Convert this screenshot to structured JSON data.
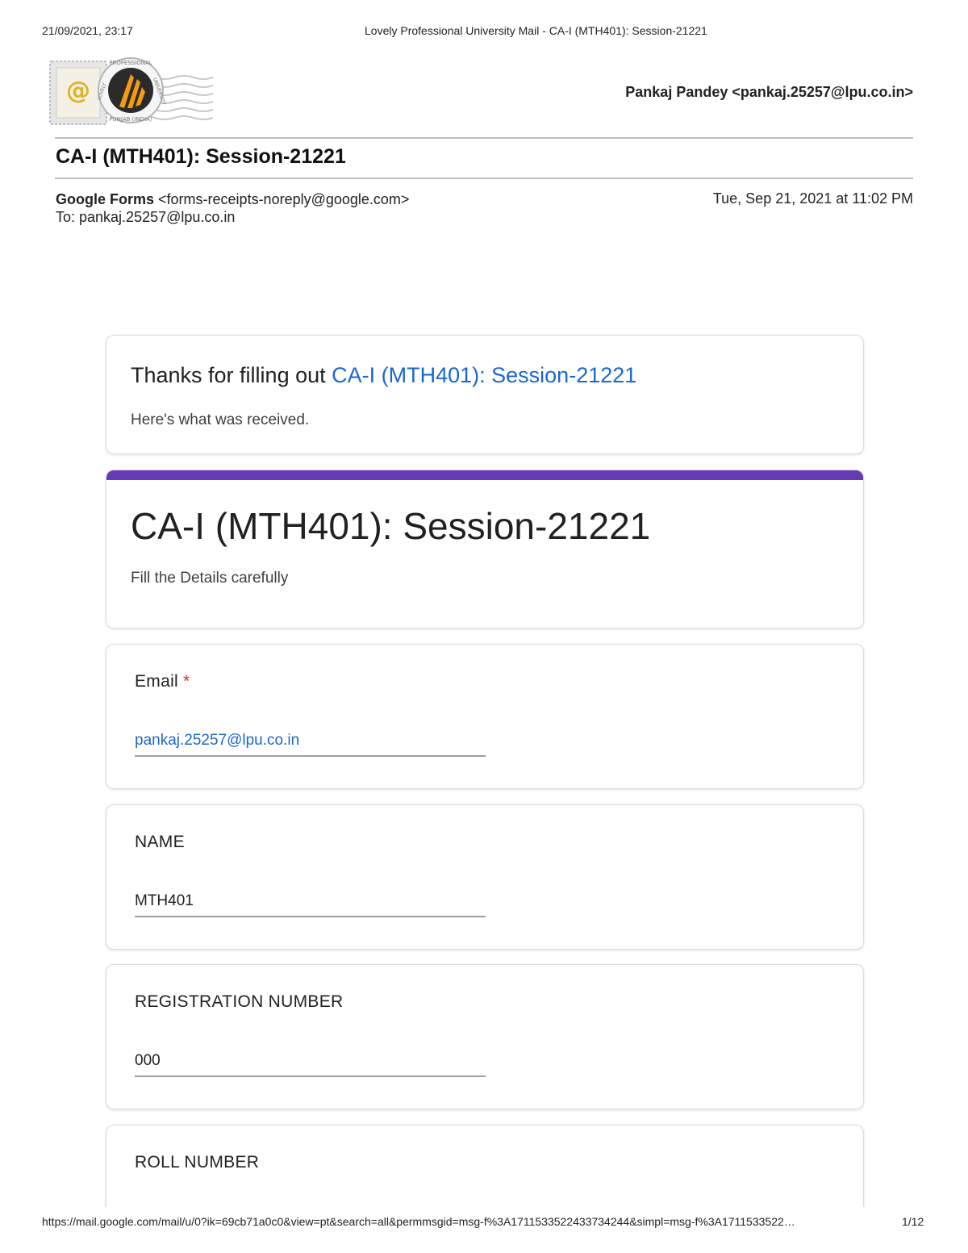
{
  "print_header": {
    "datetime": "21/09/2021, 23:17",
    "page_title": "Lovely Professional University Mail - CA-I (MTH401): Session-21221"
  },
  "logo": {
    "ring_text_top": "PROFESSIONAL",
    "ring_text_bottom": "PUNJAB (INDIA)",
    "ring_text_left": "LOVELY",
    "ring_text_right": "UNIVERSITY"
  },
  "account": "Pankaj Pandey <pankaj.25257@lpu.co.in>",
  "email": {
    "subject": "CA-I (MTH401): Session-21221",
    "from_name": "Google Forms",
    "from_address": "<forms-receipts-noreply@google.com>",
    "to": "To: pankaj.25257@lpu.co.in",
    "date": "Tue, Sep 21, 2021 at 11:02 PM"
  },
  "thanks_card": {
    "prefix": "Thanks for filling out ",
    "link_text": "CA-I (MTH401): Session-21221",
    "received": "Here's what was received."
  },
  "form": {
    "title": "CA-I (MTH401): Session-21221",
    "description": "Fill the Details carefully",
    "accent_color": "#673ab7",
    "questions": [
      {
        "label": "Email",
        "required_mark": "*",
        "answer": "pankaj.25257@lpu.co.in"
      },
      {
        "label": "NAME",
        "answer": "MTH401"
      },
      {
        "label": "REGISTRATION NUMBER",
        "answer": "000"
      },
      {
        "label": "ROLL NUMBER",
        "answer": ""
      }
    ]
  },
  "print_footer": {
    "url": "https://mail.google.com/mail/u/0?ik=69cb71a0c0&view=pt&search=all&permmsgid=msg-f%3A1711533522433734244&simpl=msg-f%3A1711533522…",
    "page": "1/12"
  }
}
